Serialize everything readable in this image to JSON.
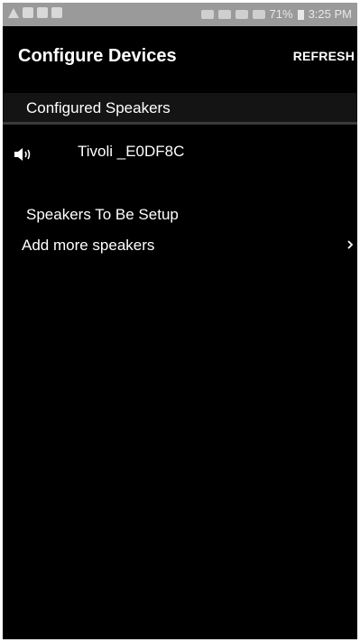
{
  "status_bar": {
    "battery_percent": "71%",
    "time": "3:25 PM"
  },
  "header": {
    "title": "Configure Devices",
    "refresh_label": "REFRESH"
  },
  "configured": {
    "section_label": "Configured Speakers",
    "speakers": [
      {
        "name": "Tivoli _E0DF8C",
        "icon": "speaker-icon"
      }
    ]
  },
  "setup": {
    "section_label": "Speakers To Be Setup",
    "add_label": "Add more speakers",
    "add_icon": "chevron-right-icon"
  },
  "colors": {
    "background": "#000000",
    "status_bar": "#9a9a9a",
    "text": "#ffffff",
    "section_band": "#141414"
  }
}
